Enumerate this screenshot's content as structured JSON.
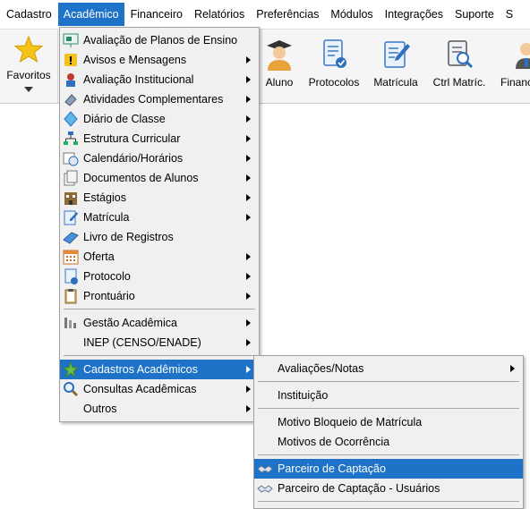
{
  "menubar": {
    "items": [
      {
        "label": "Cadastro"
      },
      {
        "label": "Acadêmico"
      },
      {
        "label": "Financeiro"
      },
      {
        "label": "Relatórios"
      },
      {
        "label": "Preferências"
      },
      {
        "label": "Módulos"
      },
      {
        "label": "Integrações"
      },
      {
        "label": "Suporte"
      },
      {
        "label": "S"
      }
    ],
    "active_index": 1,
    "active_color": "#1e73c8"
  },
  "toolbar": {
    "favorites_label": "Favoritos",
    "buttons": [
      {
        "label": "Aluno",
        "icon": "student-icon"
      },
      {
        "label": "Protocolos",
        "icon": "protocol-document-icon"
      },
      {
        "label": "Matrícula",
        "icon": "enrollment-edit-icon"
      },
      {
        "label": "Ctrl Matríc.",
        "icon": "enrollment-search-icon"
      },
      {
        "label": "Financeiro",
        "icon": "finance-user-icon"
      }
    ]
  },
  "academic_menu": {
    "items": [
      {
        "label": "Avaliação de Planos de Ensino",
        "icon": "presentation-board-icon",
        "submenu": false
      },
      {
        "label": "Avisos e Mensagens",
        "icon": "warning-icon",
        "submenu": true
      },
      {
        "label": "Avaliação Institucional",
        "icon": "person-award-icon",
        "submenu": true
      },
      {
        "label": "Atividades Complementares",
        "icon": "eraser-icon",
        "submenu": true
      },
      {
        "label": "Diário de Classe",
        "icon": "crystal-icon",
        "submenu": true
      },
      {
        "label": "Estrutura Curricular",
        "icon": "org-chart-icon",
        "submenu": true
      },
      {
        "label": "Calendário/Horários",
        "icon": "calendar-clock-icon",
        "submenu": true
      },
      {
        "label": "Documentos de Alunos",
        "icon": "documents-icon",
        "submenu": true
      },
      {
        "label": "Estágios",
        "icon": "building-icon",
        "submenu": true
      },
      {
        "label": "Matrícula",
        "icon": "enrollment-icon",
        "submenu": true
      },
      {
        "label": "Livro de Registros",
        "icon": "book-icon",
        "submenu": false
      },
      {
        "label": "Oferta",
        "icon": "calendar-grid-icon",
        "submenu": true
      },
      {
        "label": "Protocolo",
        "icon": "protocol-icon",
        "submenu": true
      },
      {
        "label": "Prontuário",
        "icon": "clipboard-icon",
        "submenu": true
      },
      {
        "label": "Gestão Acadêmica",
        "icon": "management-icon",
        "submenu": true
      },
      {
        "label": "INEP (CENSO/ENADE)",
        "icon": "",
        "submenu": true
      },
      {
        "label": "Cadastros Acadêmicos",
        "icon": "green-star-icon",
        "submenu": true
      },
      {
        "label": "Consultas Acadêmicas",
        "icon": "magnifier-icon",
        "submenu": true
      },
      {
        "label": "Outros",
        "icon": "",
        "submenu": true
      }
    ],
    "highlighted_index": 16
  },
  "cadastros_submenu": {
    "items": [
      {
        "label": "Avaliações/Notas",
        "submenu": true
      },
      {
        "label": "Instituição",
        "submenu": false
      },
      {
        "label": "Motivo Bloqueio de Matrícula",
        "submenu": false
      },
      {
        "label": "Motivos de Ocorrência",
        "submenu": false
      },
      {
        "label": "Parceiro de Captação",
        "submenu": false,
        "icon": "handshake-icon"
      },
      {
        "label": "Parceiro de Captação - Usuários",
        "submenu": false,
        "icon": "handshake-icon"
      }
    ],
    "highlighted_index": 4
  }
}
